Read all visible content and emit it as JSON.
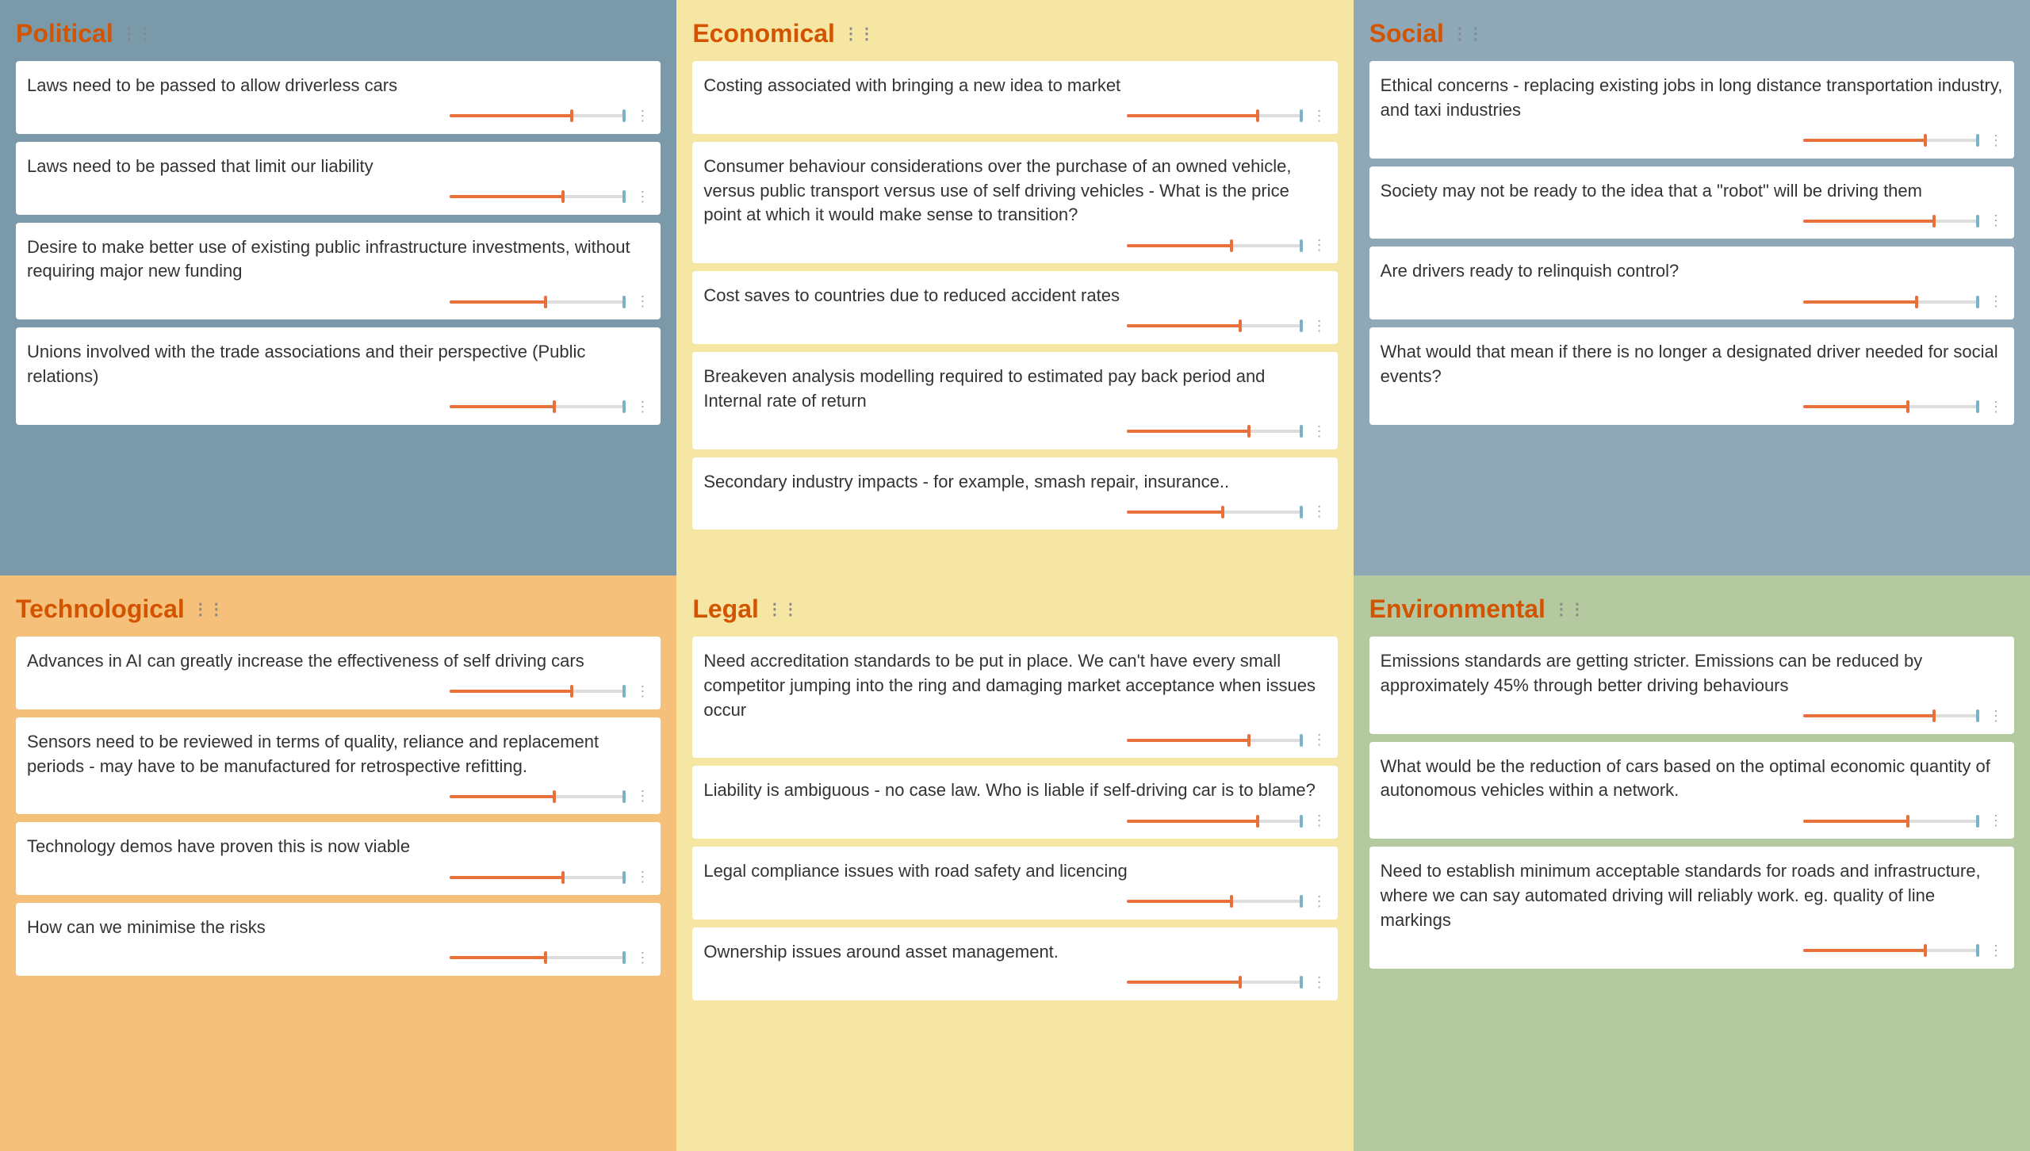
{
  "quadrants": [
    {
      "id": "political",
      "title": "Political",
      "colorClass": "political",
      "cards": [
        {
          "text": "Laws need to be passed to allow driverless cars",
          "fill": 70,
          "thumb": 70
        },
        {
          "text": "Laws need to be passed that limit our liability",
          "fill": 65,
          "thumb": 65
        },
        {
          "text": "Desire to make better use of existing public infrastructure investments, without requiring major new funding",
          "fill": 55,
          "thumb": 55
        },
        {
          "text": "Unions involved with the trade associations and their perspective (Public relations)",
          "fill": 60,
          "thumb": 60
        }
      ]
    },
    {
      "id": "economical",
      "title": "Economical",
      "colorClass": "economical",
      "cards": [
        {
          "text": "Costing associated with bringing a new idea to market",
          "fill": 75,
          "thumb": 75
        },
        {
          "text": "Consumer behaviour considerations over the purchase of an owned vehicle, versus public transport versus use of self driving vehicles - What is the price point at which it would make sense to transition?",
          "fill": 60,
          "thumb": 60
        },
        {
          "text": "Cost saves to countries due to reduced accident rates",
          "fill": 65,
          "thumb": 65
        },
        {
          "text": "Breakeven analysis modelling required to estimated pay back period and Internal rate of return",
          "fill": 70,
          "thumb": 70
        },
        {
          "text": "Secondary industry impacts - for example, smash repair, insurance..",
          "fill": 55,
          "thumb": 55
        }
      ]
    },
    {
      "id": "social",
      "title": "Social",
      "colorClass": "social",
      "cards": [
        {
          "text": "Ethical concerns - replacing existing jobs in long distance transportation industry, and taxi industries",
          "fill": 70,
          "thumb": 70
        },
        {
          "text": "Society may not be ready to the idea that a \"robot\" will be driving them",
          "fill": 75,
          "thumb": 75
        },
        {
          "text": "Are drivers ready to relinquish control?",
          "fill": 65,
          "thumb": 65
        },
        {
          "text": "What would that mean if there is no longer a designated driver needed for social events?",
          "fill": 60,
          "thumb": 60
        }
      ]
    },
    {
      "id": "technological",
      "title": "Technological",
      "colorClass": "technological",
      "cards": [
        {
          "text": "Advances in AI can greatly increase the effectiveness of self driving cars",
          "fill": 70,
          "thumb": 70
        },
        {
          "text": "Sensors need to be reviewed in terms of quality, reliance and replacement periods - may have to be manufactured for retrospective refitting.",
          "fill": 60,
          "thumb": 60
        },
        {
          "text": "Technology demos have proven this is now viable",
          "fill": 65,
          "thumb": 65
        },
        {
          "text": "How can we minimise the risks",
          "fill": 55,
          "thumb": 55
        }
      ]
    },
    {
      "id": "legal",
      "title": "Legal",
      "colorClass": "legal",
      "cards": [
        {
          "text": "Need accreditation standards to be put in place. We can't have every small competitor jumping into the ring and damaging market acceptance when issues occur",
          "fill": 70,
          "thumb": 70
        },
        {
          "text": "Liability is ambiguous - no case law. Who is liable if self-driving car is to blame?",
          "fill": 75,
          "thumb": 75
        },
        {
          "text": "Legal compliance issues with road safety and licencing",
          "fill": 60,
          "thumb": 60
        },
        {
          "text": "Ownership issues around asset management.",
          "fill": 65,
          "thumb": 65
        }
      ]
    },
    {
      "id": "environmental",
      "title": "Environmental",
      "colorClass": "environmental",
      "cards": [
        {
          "text": "Emissions standards are getting stricter. Emissions can be reduced by approximately 45% through better driving behaviours",
          "fill": 75,
          "thumb": 75
        },
        {
          "text": "What would be the reduction of cars based on the optimal economic quantity of autonomous vehicles within a network.",
          "fill": 60,
          "thumb": 60
        },
        {
          "text": "Need to establish minimum acceptable standards for roads and infrastructure, where we can say automated driving will reliably work. eg. quality of line markings",
          "fill": 70,
          "thumb": 70
        }
      ]
    }
  ],
  "drag_icon": "⋮⋮",
  "dots_icon": "⋮"
}
